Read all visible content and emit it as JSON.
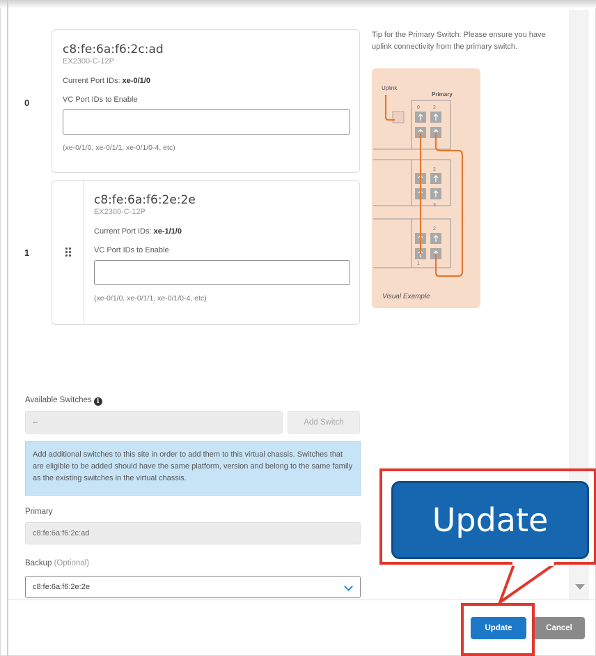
{
  "vc_members": [
    {
      "index": "0",
      "mac": "c8:fe:6a:f6:2c:ad",
      "model": "EX2300-C-12P",
      "current_ports_label": "Current Port IDs:",
      "current_ports_value": "xe-0/1/0",
      "vc_ports_label": "VC Port IDs to Enable",
      "vc_ports_value": "",
      "hint": "(xe-0/1/0, xe-0/1/1, xe-0/1/0-4, etc)"
    },
    {
      "index": "1",
      "mac": "c8:fe:6a:f6:2e:2e",
      "model": "EX2300-C-12P",
      "current_ports_label": "Current Port IDs:",
      "current_ports_value": "xe-1/1/0",
      "vc_ports_label": "VC Port IDs to Enable",
      "vc_ports_value": "",
      "hint": "(xe-0/1/0, xe-0/1/1, xe-0/1/0-4, etc)"
    }
  ],
  "tip": {
    "text": "Tip for the Primary Switch: Please ensure you have uplink connectivity from the primary switch.",
    "diagram_uplink_label": "Uplink",
    "diagram_primary_label": "Primary",
    "diagram_port_numbers": [
      "0",
      "2",
      "2",
      "3",
      "2",
      "1"
    ],
    "caption": "Visual Example",
    "accent_color": "#e07a2e",
    "background_color": "#f8dcca"
  },
  "available_switches": {
    "label": "Available Switches",
    "info_icon": "info-icon",
    "value": "--",
    "add_button": "Add Switch",
    "banner": "Add additional switches to this site in order to add them to this virtual chassis. Switches that are eligible to be added should have the same platform, version and belong to the same family as the existing switches in the virtual chassis."
  },
  "primary": {
    "label": "Primary",
    "value": "c8:fe:6a:f6:2c:ad"
  },
  "backup": {
    "label": "Backup",
    "optional": "(Optional)",
    "value": "c8:fe:6a:f6:2e:2e"
  },
  "footer": {
    "update": "Update",
    "cancel": "Cancel"
  },
  "callout": {
    "label": "Update",
    "border_color": "#e0382e",
    "button_color": "#1667b0"
  }
}
